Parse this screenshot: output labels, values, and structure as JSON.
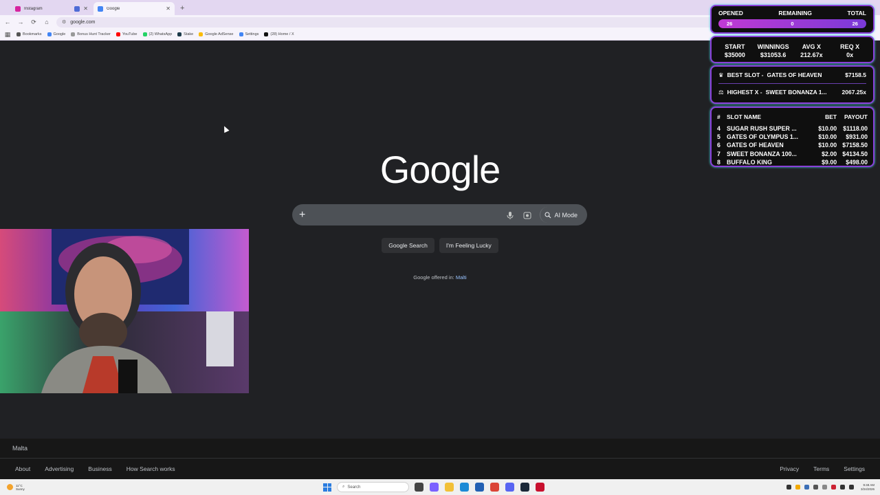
{
  "browser": {
    "tabs": [
      {
        "title": "Instagram",
        "favicon_color": "#d6249f",
        "active": false
      },
      {
        "title": "Google",
        "favicon_color": "#4285f4",
        "active": true
      }
    ],
    "new_tab_label": "+",
    "url": "google.com",
    "bookmarks": [
      {
        "label": "Bookmarks",
        "color": "#555555"
      },
      {
        "label": "Google",
        "color": "#4285f4"
      },
      {
        "label": "Bonus Hunt Tracker",
        "color": "#999999"
      },
      {
        "label": "YouTube",
        "color": "#ff0000"
      },
      {
        "label": "(2) WhatsApp",
        "color": "#25d366"
      },
      {
        "label": "Stake",
        "color": "#1c3a4a"
      },
      {
        "label": "Google AdSense",
        "color": "#fbbc05"
      },
      {
        "label": "Settings",
        "color": "#4285f4"
      },
      {
        "label": "(28) Home / X",
        "color": "#111111"
      }
    ]
  },
  "google": {
    "logo": "Google",
    "search_placeholder": "",
    "ai_mode_label": "AI Mode",
    "search_button": "Google Search",
    "lucky_button": "I'm Feeling Lucky",
    "offered_prefix": "Google offered in:",
    "offered_language": "Malti",
    "footer_country": "Malta",
    "footer_left_links": [
      "About",
      "Advertising",
      "Business",
      "How Search works"
    ],
    "footer_right_links": [
      "Privacy",
      "Terms",
      "Settings"
    ]
  },
  "overlay": {
    "progress": {
      "opened_label": "OPENED",
      "remaining_label": "REMAINING",
      "total_label": "TOTAL",
      "opened": "26",
      "remaining": "0",
      "total": "26"
    },
    "stats": [
      {
        "label": "START",
        "value": "$35000"
      },
      {
        "label": "WINNINGS",
        "value": "$31053.6"
      },
      {
        "label": "AVG X",
        "value": "212.67x"
      },
      {
        "label": "REQ X",
        "value": "0x"
      }
    ],
    "best_slot": {
      "label": "BEST SLOT -",
      "name": "GATES OF HEAVEN",
      "value": "$7158.5"
    },
    "highest_x": {
      "label": "HIGHEST X -",
      "name": "SWEET BONANZA 1...",
      "value": "2067.25x"
    },
    "table": {
      "headers": {
        "num": "#",
        "name": "SLOT NAME",
        "bet": "BET",
        "payout": "PAYOUT"
      },
      "rows": [
        {
          "num": "4",
          "name": "SUGAR RUSH SUPER ...",
          "bet": "$10.00",
          "payout": "$1118.00"
        },
        {
          "num": "5",
          "name": "GATES OF OLYMPUS 1...",
          "bet": "$10.00",
          "payout": "$931.00"
        },
        {
          "num": "6",
          "name": "GATES OF HEAVEN",
          "bet": "$10.00",
          "payout": "$7158.50"
        },
        {
          "num": "7",
          "name": "SWEET BONANZA 100...",
          "bet": "$2.00",
          "payout": "$4134.50"
        },
        {
          "num": "8",
          "name": "BUFFALO KING",
          "bet": "$9.00",
          "payout": "$498.00"
        }
      ]
    }
  },
  "taskbar": {
    "weather_temp": "11°C",
    "weather_desc": "Sunny",
    "search_placeholder": "Search",
    "time": "9:48 AM",
    "date": "3/24/2026"
  },
  "colors": {
    "page_bg": "#202124",
    "overlay_border": "#8b3fd9",
    "overlay_glow": "#43d3e8",
    "progress_bar": "#c03ad4"
  }
}
